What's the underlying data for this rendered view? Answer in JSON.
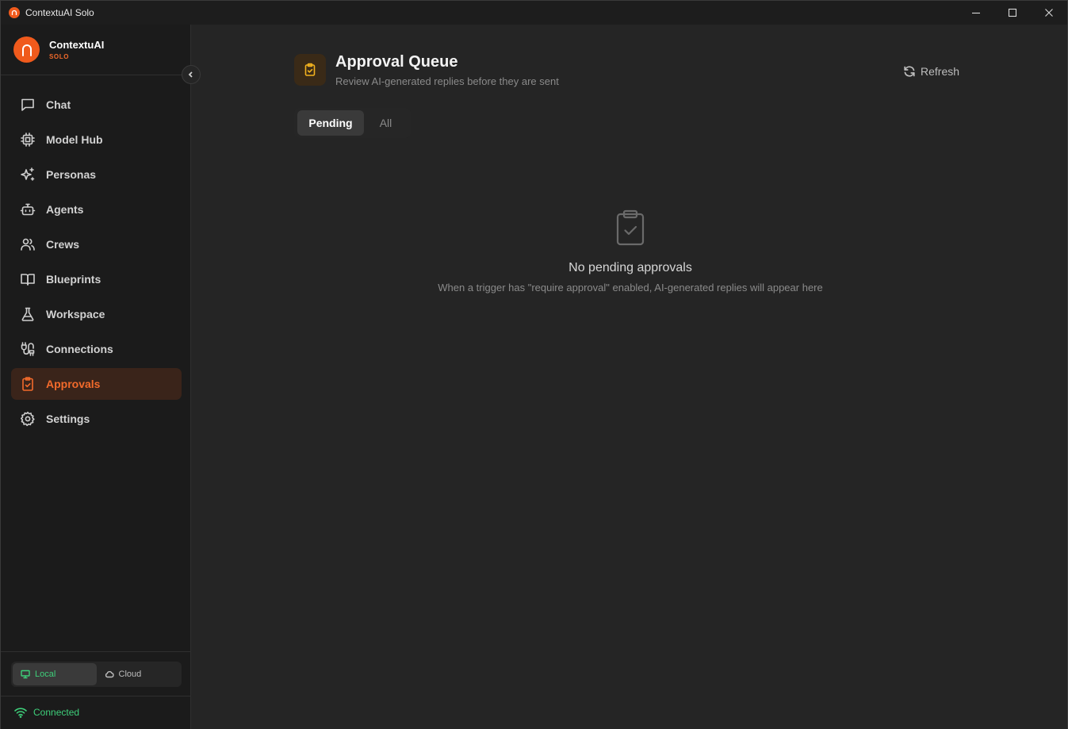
{
  "window": {
    "title": "ContextuAI Solo",
    "controls": [
      "minimize-icon",
      "maximize-icon",
      "close-icon"
    ]
  },
  "brand": {
    "name": "ContextuAI",
    "edition": "SOLO",
    "accent": "#f05a1c"
  },
  "sidebar": {
    "items": [
      {
        "label": "Chat",
        "icon": "chat-icon",
        "active": false
      },
      {
        "label": "Model Hub",
        "icon": "chip-icon",
        "active": false
      },
      {
        "label": "Personas",
        "icon": "sparkles-icon",
        "active": false
      },
      {
        "label": "Agents",
        "icon": "bot-icon",
        "active": false
      },
      {
        "label": "Crews",
        "icon": "users-icon",
        "active": false
      },
      {
        "label": "Blueprints",
        "icon": "book-icon",
        "active": false
      },
      {
        "label": "Workspace",
        "icon": "flask-icon",
        "active": false
      },
      {
        "label": "Connections",
        "icon": "plug-icon",
        "active": false
      },
      {
        "label": "Approvals",
        "icon": "clipboard-check-icon",
        "active": true
      },
      {
        "label": "Settings",
        "icon": "gear-icon",
        "active": false
      }
    ],
    "mode": {
      "local_label": "Local",
      "cloud_label": "Cloud",
      "selected": "Local"
    },
    "status": {
      "label": "Connected",
      "color": "#3ecf7a"
    }
  },
  "main": {
    "title": "Approval Queue",
    "subtitle": "Review AI-generated replies before they are sent",
    "refresh_label": "Refresh",
    "tabs": [
      {
        "label": "Pending",
        "active": true
      },
      {
        "label": "All",
        "active": false
      }
    ],
    "empty_state": {
      "title": "No pending approvals",
      "description": "When a trigger has \"require approval\" enabled, AI-generated replies will appear here"
    }
  }
}
